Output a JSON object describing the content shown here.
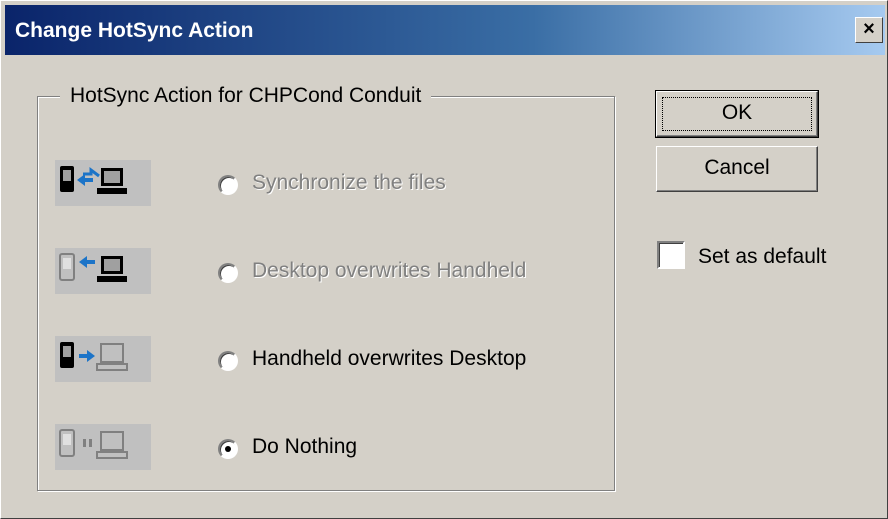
{
  "window": {
    "title": "Change HotSync Action",
    "close_glyph": "×"
  },
  "group": {
    "label": "HotSync Action for CHPCond Conduit",
    "options": [
      {
        "label": "Synchronize the files",
        "enabled": false,
        "selected": false,
        "icon": "handheld-sync-desktop-icon"
      },
      {
        "label": "Desktop overwrites Handheld",
        "enabled": false,
        "selected": false,
        "icon": "desktop-to-handheld-icon"
      },
      {
        "label": "Handheld overwrites Desktop",
        "enabled": true,
        "selected": false,
        "icon": "handheld-to-desktop-icon"
      },
      {
        "label": "Do Nothing",
        "enabled": true,
        "selected": true,
        "icon": "do-nothing-icon"
      }
    ]
  },
  "buttons": {
    "ok_label": "OK",
    "cancel_label": "Cancel"
  },
  "default_checkbox": {
    "label": "Set as default",
    "checked": false
  },
  "colors": {
    "dialog_bg": "#d4d0c8",
    "titlebar_start": "#0a246a",
    "titlebar_end": "#a6caf0",
    "arrow_blue": "#1c74c8",
    "device_dark": "#000000",
    "device_grey": "#a0a0a0"
  }
}
